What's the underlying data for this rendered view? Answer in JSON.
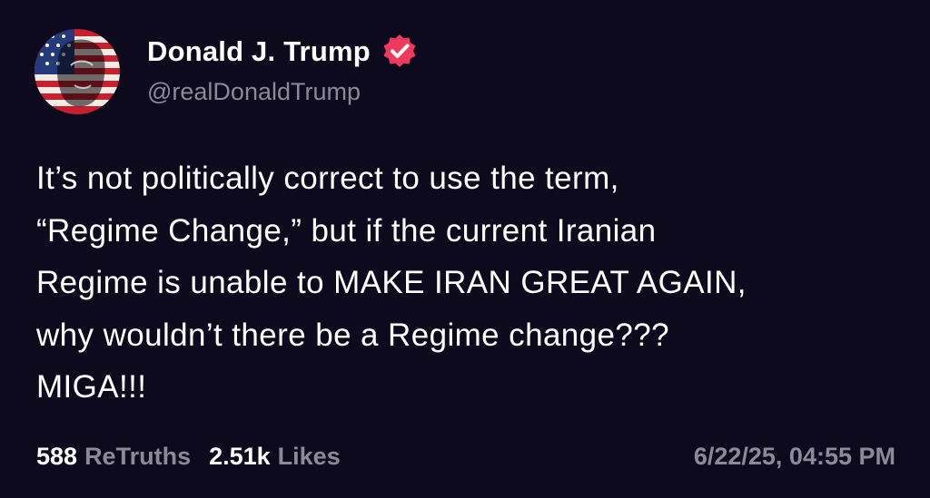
{
  "author": {
    "display_name": "Donald J. Trump",
    "handle": "@realDonaldTrump",
    "verified_icon": "verified-badge-icon",
    "verified_color": "#ee3a5c"
  },
  "post": {
    "lines": [
      "It’s not politically correct to use the term,",
      "“Regime Change,” but if the current Iranian",
      "Regime is unable to MAKE IRAN GREAT AGAIN,",
      "why wouldn’t there be a Regime change???",
      "MIGA!!!"
    ]
  },
  "stats": {
    "retruths_count": "588",
    "retruths_label": "ReTruths",
    "likes_count": "2.51k",
    "likes_label": "Likes"
  },
  "timestamp": "6/22/25, 04:55 PM",
  "colors": {
    "background": "#0e0a1d",
    "muted_text": "#8c8a99",
    "primary_text": "#ffffff"
  }
}
